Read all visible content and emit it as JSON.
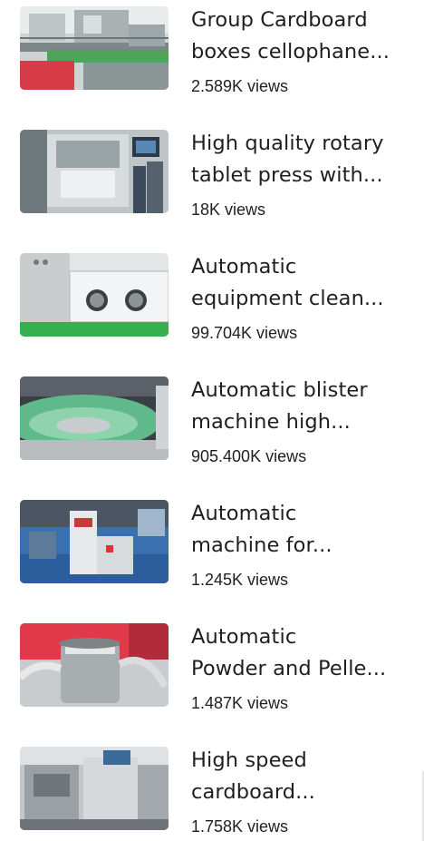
{
  "videos": [
    {
      "title_line1": "Group Cardboard",
      "title_line2": "boxes cellophane...",
      "views": "2.589K views",
      "thumb": "packaging-line-thumbnail"
    },
    {
      "title_line1": "High quality rotary",
      "title_line2": "tablet press with...",
      "views": "18K views",
      "thumb": "tablet-press-thumbnail"
    },
    {
      "title_line1": "Automatic",
      "title_line2": "equipment clean...",
      "views": "99.704K views",
      "thumb": "glovebox-thumbnail"
    },
    {
      "title_line1": "Automatic blister",
      "title_line2": "machine high...",
      "views": "905.400K views",
      "thumb": "blister-machine-thumbnail"
    },
    {
      "title_line1": "Automatic",
      "title_line2": "machine for...",
      "views": "1.245K views",
      "thumb": "exhibition-machine-thumbnail"
    },
    {
      "title_line1": "Automatic",
      "title_line2": "Powder and Pelle...",
      "views": "1.487K views",
      "thumb": "vacuum-loader-thumbnail"
    },
    {
      "title_line1": "High speed",
      "title_line2": "cardboard...",
      "views": "1.758K views",
      "thumb": "cartoning-machine-thumbnail"
    }
  ]
}
